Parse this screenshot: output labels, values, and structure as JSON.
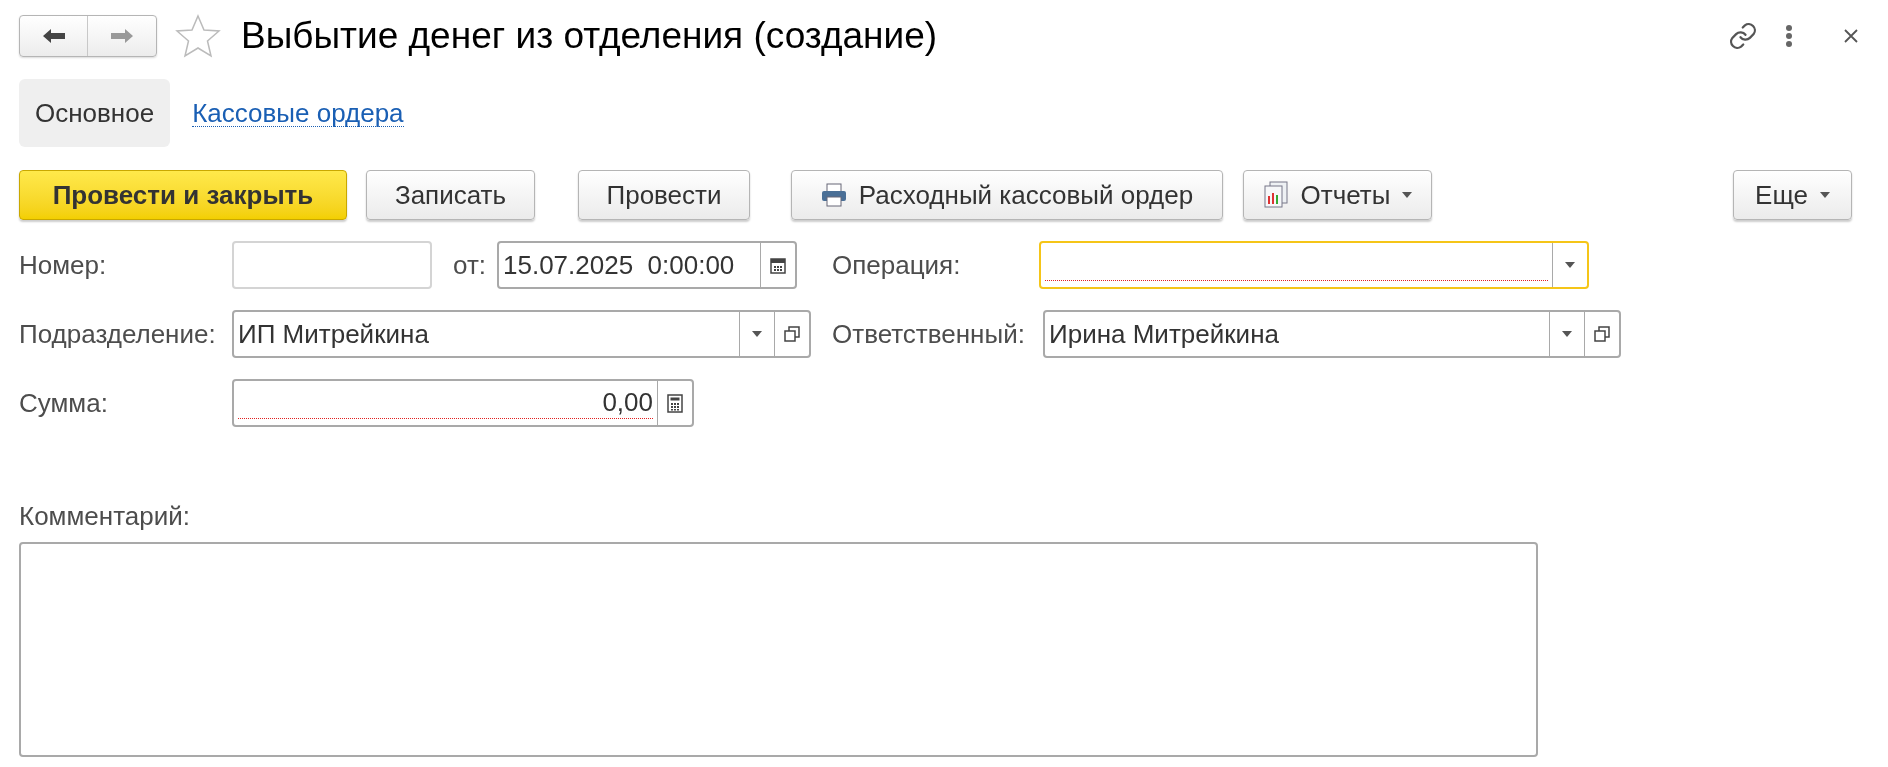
{
  "header": {
    "title": "Выбытие денег из отделения (создание)",
    "favorite": false
  },
  "tabs": [
    {
      "label": "Основное",
      "selected": true
    },
    {
      "label": "Кассовые ордера",
      "selected": false
    }
  ],
  "toolbar": [
    {
      "label": "Провести и закрыть",
      "primary": true,
      "kind": "plain",
      "menu": false
    },
    {
      "label": "Записать",
      "primary": false,
      "kind": "plain",
      "menu": false
    },
    {
      "label": "Провести",
      "primary": false,
      "kind": "plain",
      "menu": false
    },
    {
      "label": "Расходный кассовый ордер",
      "primary": false,
      "kind": "print",
      "menu": false
    },
    {
      "label": "Отчеты",
      "primary": false,
      "kind": "reports",
      "menu": true
    }
  ],
  "more_button": {
    "label": "Еще",
    "menu": true
  },
  "fields": {
    "number": {
      "label": "Номер:",
      "disabled": true
    },
    "date": {
      "label": "от:",
      "value": "15.07.2025  0:00:00"
    },
    "operation": {
      "label": "Операция:",
      "focused": true,
      "invalid": true
    },
    "department": {
      "label": "Подразделение:",
      "value": "ИП Митрейкина"
    },
    "responsible": {
      "label": "Ответственный:",
      "value": "Ирина Митрейкина"
    },
    "amount": {
      "label": "Сумма:",
      "value": "0,00",
      "invalid": true
    },
    "comment": {
      "label": "Комментарий:"
    }
  }
}
